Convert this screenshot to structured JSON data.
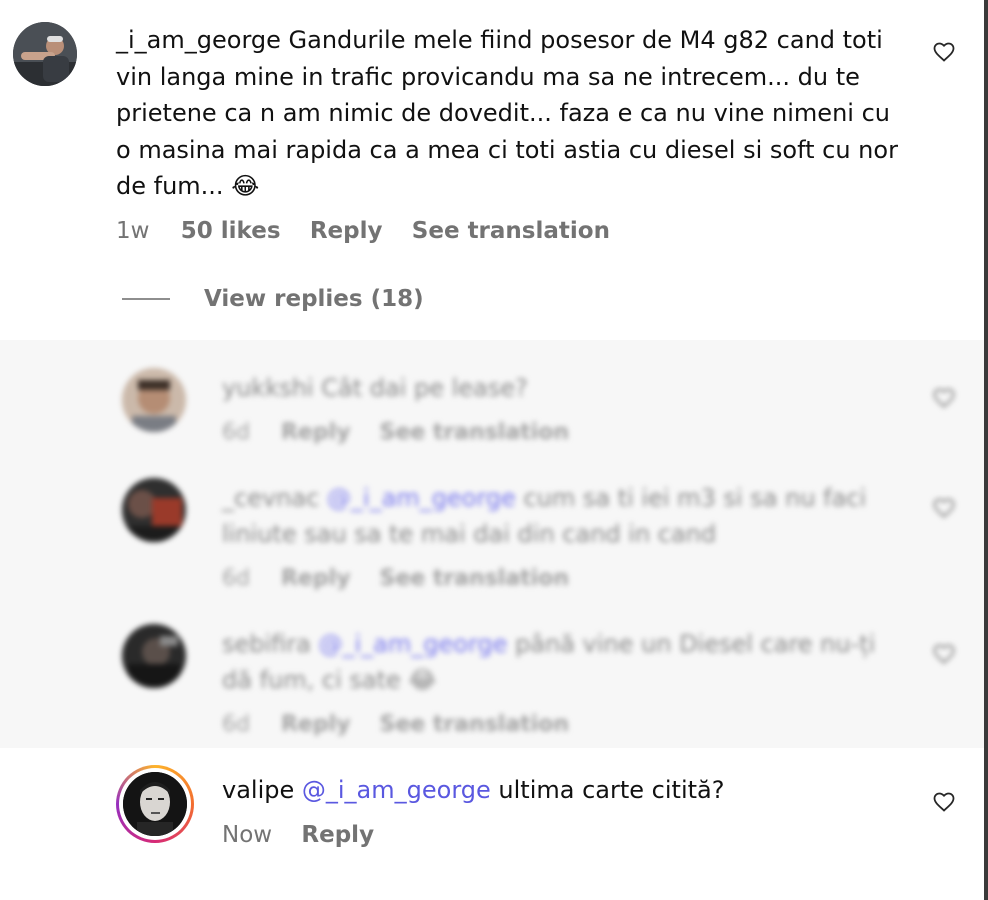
{
  "main_comment": {
    "username": "_i_am_george",
    "text": "Gandurile mele fiind posesor de M4 g82 cand toti vin langa mine in trafic provicandu ma sa ne intrecem... du te prietene ca n am nimic de dovedit... faza e ca nu vine nimeni cu o masina mai rapida ca a mea ci toti astia cu diesel si soft cu nor de fum...",
    "emoji": "😂",
    "time": "1w",
    "likes": "50 likes",
    "reply_label": "Reply",
    "translate_label": "See translation",
    "like_icon": "heart-outline-icon"
  },
  "view_replies": "View replies (18)",
  "replies": [
    {
      "username": "yukkshi",
      "text": "Cât dai pe lease?",
      "mention": "",
      "time": "6d",
      "reply_label": "Reply",
      "translate_label": "See translation"
    },
    {
      "username": "_cevnac",
      "mention": "@_i_am_george",
      "text": "cum sa ti iei m3 si sa nu faci liniute sau sa te mai dai din cand in cand",
      "time": "6d",
      "reply_label": "Reply",
      "translate_label": "See translation"
    },
    {
      "username": "sebifira",
      "mention": "@_i_am_george",
      "text": "până vine un Diesel care nu-ți dă fum, ci sate",
      "emoji": "😂",
      "time": "6d",
      "reply_label": "Reply",
      "translate_label": "See translation"
    }
  ],
  "last_reply": {
    "username": "valipe",
    "mention": "@_i_am_george",
    "text": "ultima carte citită?",
    "time": "Now",
    "reply_label": "Reply"
  },
  "colors": {
    "mention": "#5a58e0",
    "muted": "#737373",
    "story_ring": "#d62976",
    "scrollbar": "#3a3a3a"
  }
}
